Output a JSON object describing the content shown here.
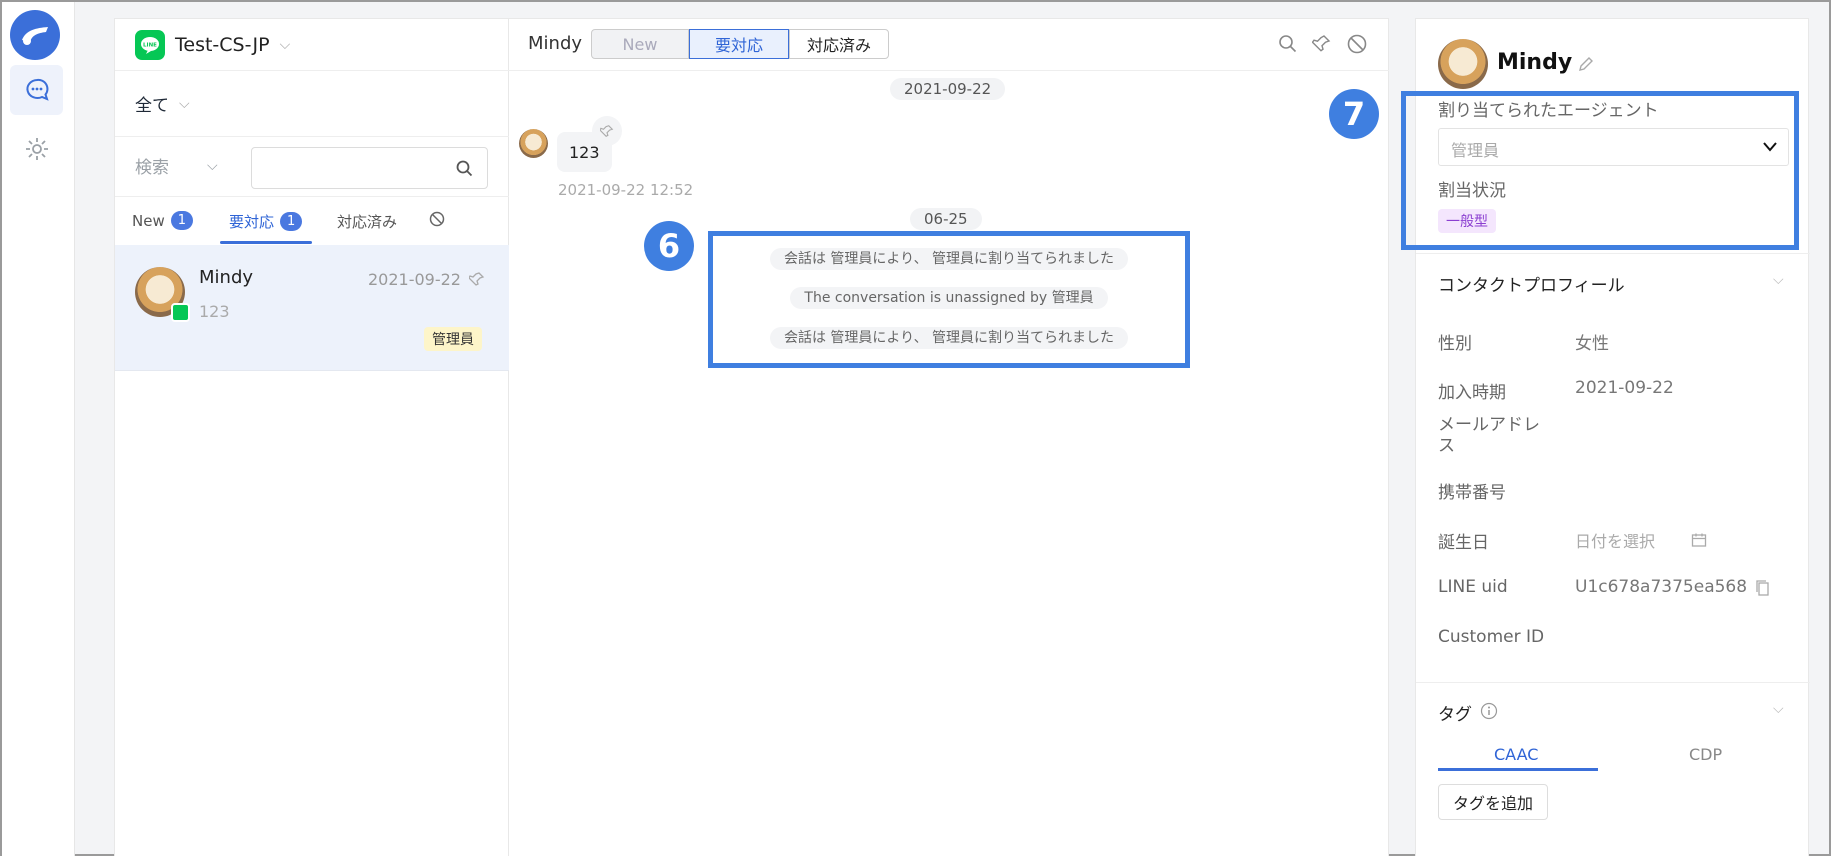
{
  "channel": {
    "name": "Test-CS-JP",
    "icon": "line-icon"
  },
  "list": {
    "filter_label": "全て",
    "search_select": "検索",
    "search_placeholder": "",
    "tabs": [
      {
        "label": "New",
        "count": "1"
      },
      {
        "label": "要対応",
        "count": "1"
      },
      {
        "label": "対応済み"
      }
    ],
    "conversation": {
      "name": "Mindy",
      "date": "2021-09-22",
      "preview": "123",
      "assignee": "管理員"
    }
  },
  "chat": {
    "contact_name": "Mindy",
    "status_tabs": [
      "New",
      "要対応",
      "対応済み"
    ],
    "date1": "2021-09-22",
    "message_text": "123",
    "message_time": "2021-09-22 12:52",
    "date2": "06-25",
    "system_messages": [
      "会話は 管理員により、 管理員に割り当てられました",
      "The conversation is unassigned by 管理員",
      "会話は 管理員により、 管理員に割り当てられました"
    ],
    "callout_left": "6",
    "callout_right": "7"
  },
  "profile": {
    "name": "Mindy",
    "assigned_agent_label": "割り当てられたエージェント",
    "assigned_agent_value": "管理員",
    "assign_status_label": "割当状況",
    "assign_status_tag": "一般型",
    "contact_profile_title": "コンタクトプロフィール",
    "fields": {
      "gender_label": "性別",
      "gender_value": "女性",
      "joined_label": "加入時期",
      "joined_value": "2021-09-22",
      "email_label": "メールアドレス",
      "phone_label": "携帯番号",
      "birthday_label": "誕生日",
      "birthday_placeholder": "日付を選択",
      "line_uid_label": "LINE uid",
      "line_uid_value": "U1c678a7375ea568",
      "customer_id_label": "Customer ID"
    },
    "tags_title": "タグ",
    "tag_tabs": [
      "CAAC",
      "CDP"
    ],
    "add_tag_button": "タグを追加"
  },
  "colors": {
    "accent": "#3b6fd9",
    "highlight": "#3f7fe0",
    "line_green": "#06c755",
    "tag_purple": "#8b3fd1"
  }
}
